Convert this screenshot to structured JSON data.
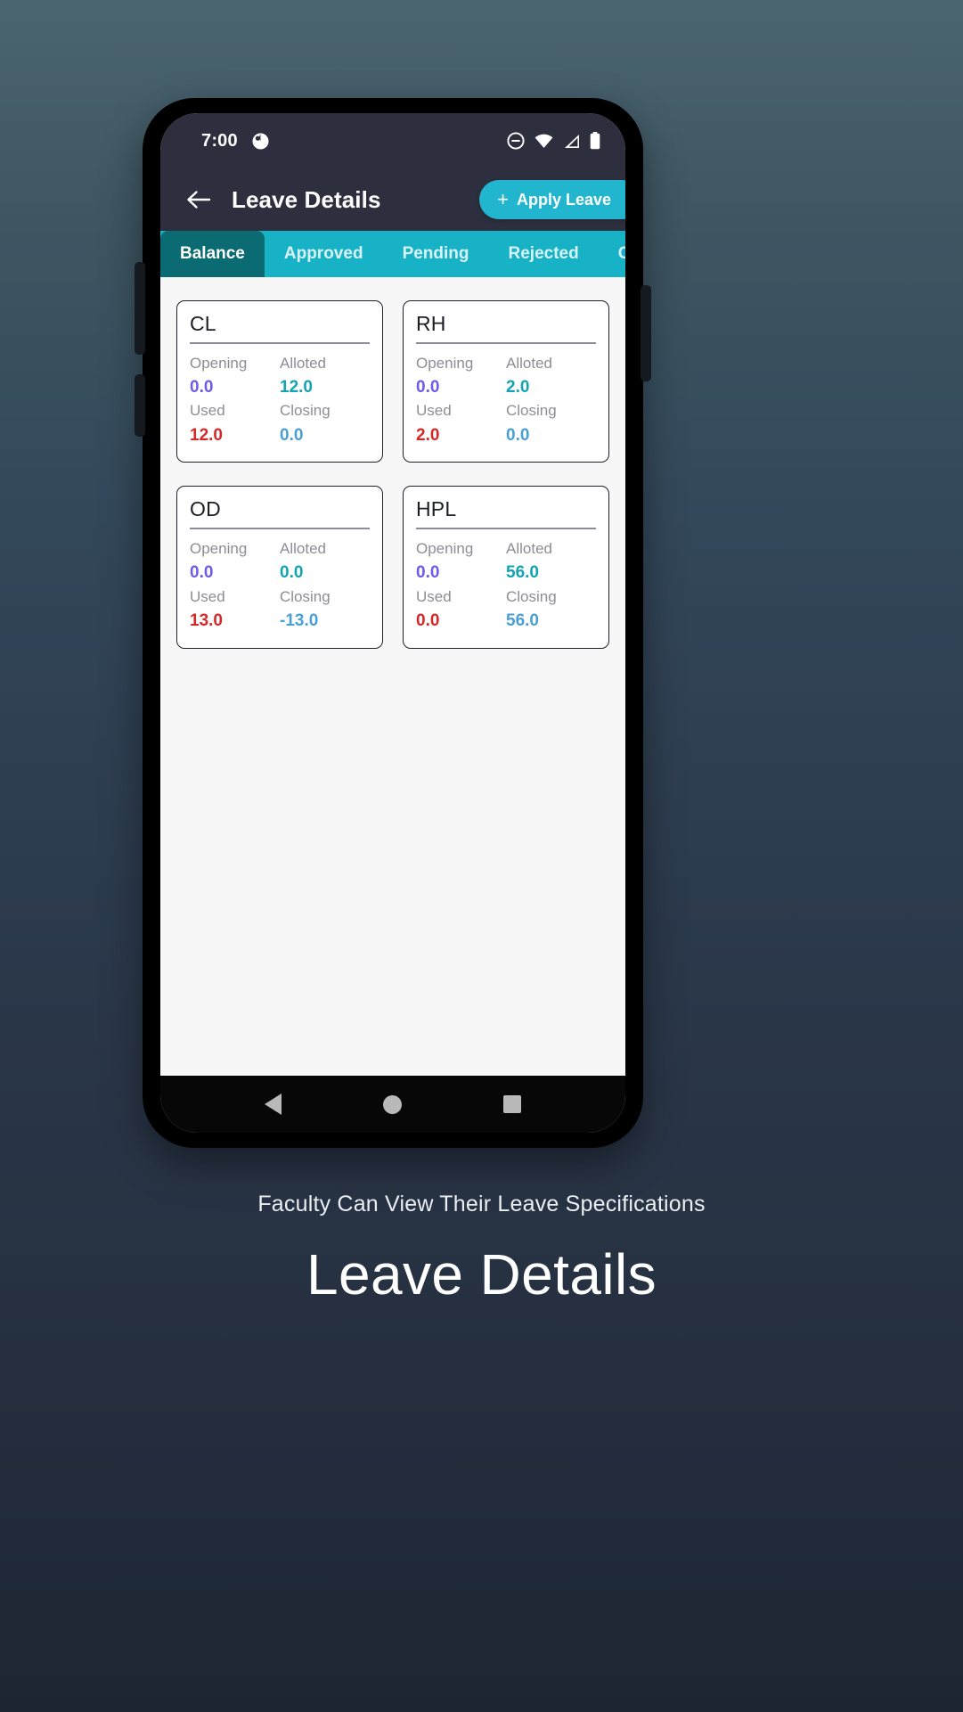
{
  "status_bar": {
    "time": "7:00",
    "icons_left": [
      "notification-dot-icon"
    ],
    "icons_right": [
      "do-not-disturb-icon",
      "wifi-icon",
      "cellular-signal-icon",
      "battery-icon"
    ]
  },
  "app_bar": {
    "back_icon": "arrow-left-icon",
    "title": "Leave Details",
    "apply_button": {
      "label": "Apply Leave",
      "icon": "plus-icon"
    }
  },
  "tabs": {
    "items": [
      {
        "label": "Balance",
        "active": true
      },
      {
        "label": "Approved",
        "active": false
      },
      {
        "label": "Pending",
        "active": false
      },
      {
        "label": "Rejected",
        "active": false
      },
      {
        "label": "C",
        "active": false
      }
    ]
  },
  "balance_cards": {
    "labels": {
      "opening": "Opening",
      "alloted": "Alloted",
      "used": "Used",
      "closing": "Closing"
    },
    "items": [
      {
        "code": "CL",
        "opening": "0.0",
        "alloted": "12.0",
        "used": "12.0",
        "closing": "0.0"
      },
      {
        "code": "RH",
        "opening": "0.0",
        "alloted": "2.0",
        "used": "2.0",
        "closing": "0.0"
      },
      {
        "code": "OD",
        "opening": "0.0",
        "alloted": "0.0",
        "used": "13.0",
        "closing": "-13.0"
      },
      {
        "code": "HPL",
        "opening": "0.0",
        "alloted": "56.0",
        "used": "0.0",
        "closing": "56.0"
      }
    ]
  },
  "nav_bar": {
    "back": "nav-back-icon",
    "home": "nav-home-icon",
    "recents": "nav-recents-icon"
  },
  "captions": {
    "subtitle": "Faculty Can View Their Leave Specifications",
    "title": "Leave Details"
  },
  "colors": {
    "accent_teal": "#17b2c6",
    "tab_active": "#0b6b72",
    "appbar": "#2d2f3f",
    "opening": "#6c5ce7",
    "alloted": "#12a4b4",
    "used": "#d62828",
    "closing": "#4a9fd4"
  }
}
